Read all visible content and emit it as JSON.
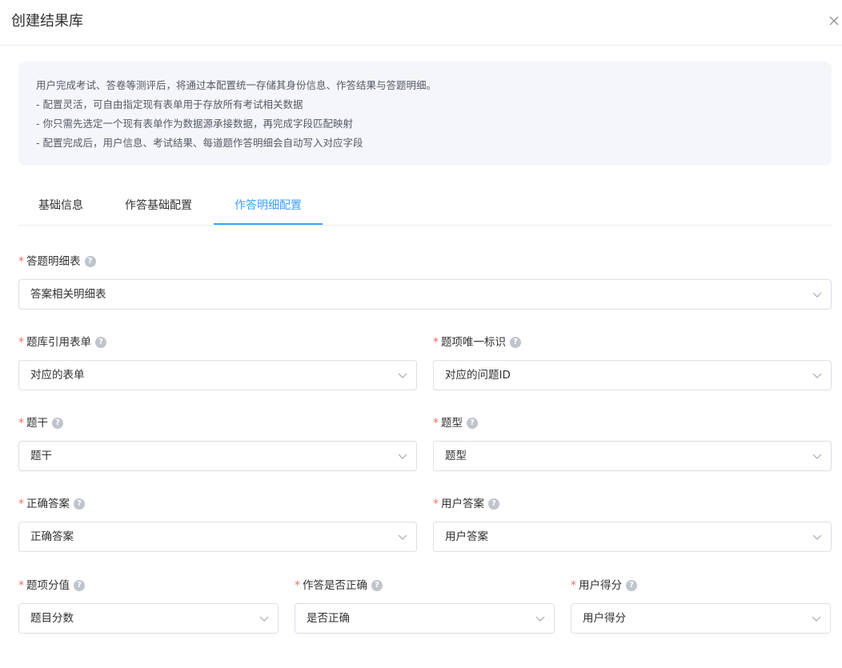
{
  "dialog": {
    "title": "创建结果库",
    "close_icon": "close-icon"
  },
  "info": {
    "lines": [
      "用户完成考试、答卷等测评后，将通过本配置统一存储其身份信息、作答结果与答题明细。",
      "- 配置灵活，可自由指定现有表单用于存放所有考试相关数据",
      "- 你只需先选定一个现有表单作为数据源承接数据，再完成字段匹配映射",
      "- 配置完成后，用户信息、考试结果、每道题作答明细会自动写入对应字段"
    ]
  },
  "tabs": [
    {
      "label": "基础信息",
      "active": false
    },
    {
      "label": "作答基础配置",
      "active": false
    },
    {
      "label": "作答明细配置",
      "active": true
    }
  ],
  "form": {
    "answer_detail_table": {
      "label": "答题明细表",
      "required": "*",
      "value": "答案相关明细表"
    },
    "bank_ref_form": {
      "label": "题库引用表单",
      "required": "*",
      "value": "对应的表单"
    },
    "item_unique_id": {
      "label": "题项唯一标识",
      "required": "*",
      "value": "对应的问题ID"
    },
    "stem": {
      "label": "题干",
      "required": "*",
      "value": "题干"
    },
    "question_type": {
      "label": "题型",
      "required": "*",
      "value": "题型"
    },
    "correct_answer": {
      "label": "正确答案",
      "required": "*",
      "value": "正确答案"
    },
    "user_answer": {
      "label": "用户答案",
      "required": "*",
      "value": "用户答案"
    },
    "item_score": {
      "label": "题项分值",
      "required": "*",
      "value": "题目分数"
    },
    "is_correct": {
      "label": "作答是否正确",
      "required": "*",
      "value": "是否正确"
    },
    "user_score": {
      "label": "用户得分",
      "required": "*",
      "value": "用户得分"
    }
  },
  "help_glyph": "?",
  "colors": {
    "accent": "#409eff",
    "required": "#f56c6c",
    "info_bg": "#f4f6f9",
    "border": "#dcdfe6"
  }
}
